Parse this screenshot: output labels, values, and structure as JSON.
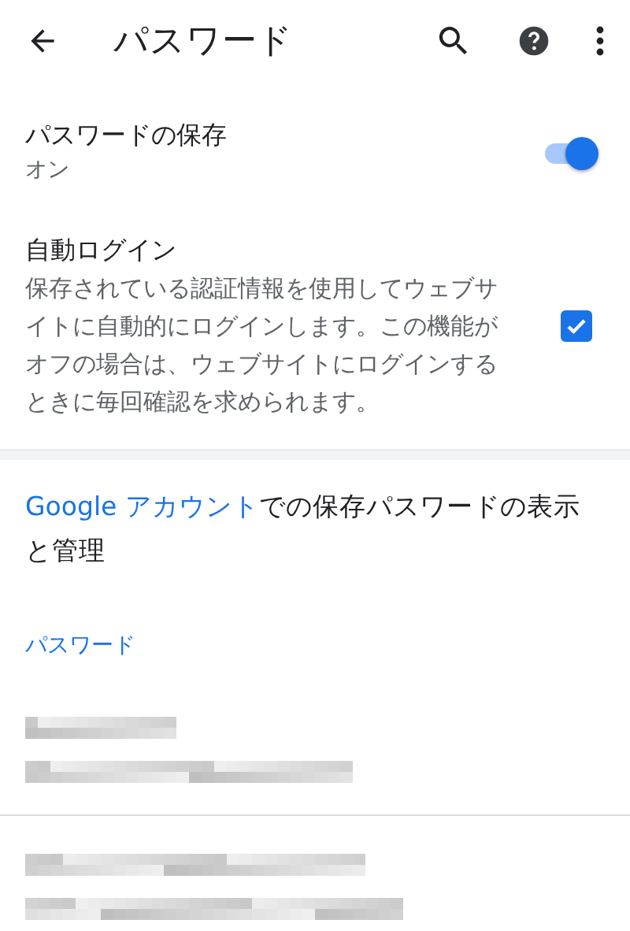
{
  "toolbar": {
    "title": "パスワード"
  },
  "save_passwords": {
    "title": "パスワードの保存",
    "subtitle": "オン",
    "on": true
  },
  "auto_signin": {
    "title": "自動ログイン",
    "description": "保存されている認証情報を使用してウェブサイトに自動的にログインします。この機能がオフの場合は、ウェブサイトにログインするときに毎回確認を求められます。",
    "checked": true
  },
  "account_note": {
    "link": "Google アカウント",
    "rest": "での保存パスワードの表示と管理"
  },
  "section_header": "パスワード",
  "entries": [
    {
      "redacted": true
    },
    {
      "redacted": true
    }
  ]
}
